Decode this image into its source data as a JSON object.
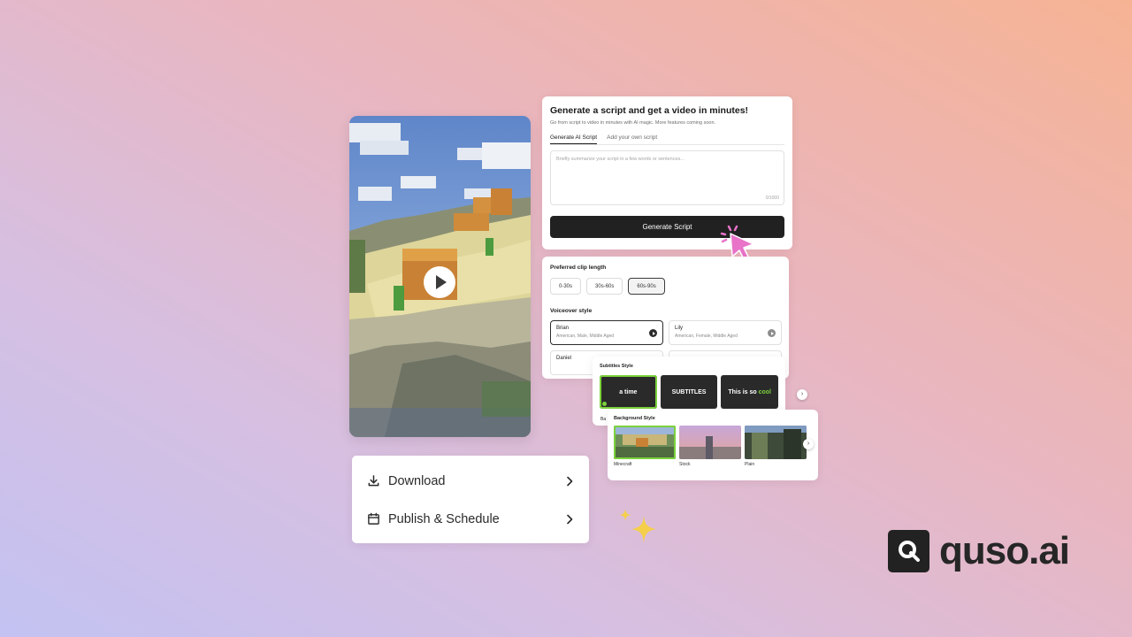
{
  "video": {
    "play_icon": "play-icon"
  },
  "script_generator": {
    "title": "Generate a script and get a video in minutes!",
    "subtitle": "Go from script to video in minutes with AI magic. More features coming soon.",
    "tabs": [
      "Generate AI Script",
      "Add your own script"
    ],
    "active_tab": "Generate AI Script",
    "input_placeholder": "Briefly summarize your script in a few words or sentences...",
    "char_count": "0/1000",
    "button_label": "Generate Script"
  },
  "clip_length": {
    "label": "Preferred clip length",
    "options": [
      "0-30s",
      "30s-60s",
      "60s-90s"
    ],
    "selected": "60s-90s"
  },
  "voiceover": {
    "label": "Voiceover style",
    "voices": [
      {
        "name": "Brian",
        "desc": "American, Male, Middle Aged",
        "selected": true
      },
      {
        "name": "Lily",
        "desc": "American, Female, Middle Aged",
        "selected": false
      },
      {
        "name": "Daniel",
        "desc": "",
        "selected": false
      },
      {
        "name": "",
        "desc": "",
        "selected": false
      }
    ]
  },
  "subtitles": {
    "label": "Subtitles Style",
    "tiles": [
      {
        "text": "a time",
        "highlight": ""
      },
      {
        "text": "SUBTITLES",
        "highlight": ""
      },
      {
        "text": "This is so ",
        "highlight": "cool"
      }
    ],
    "peek_label": "Ba"
  },
  "background": {
    "label": "Background Style",
    "items": [
      {
        "name": "Minecraft",
        "selected": true
      },
      {
        "name": "Stock",
        "selected": false
      },
      {
        "name": "Plain",
        "selected": false
      }
    ]
  },
  "actions": {
    "download_label": "Download",
    "publish_label": "Publish & Schedule"
  },
  "brand": {
    "name": "quso.ai"
  },
  "colors": {
    "accent_green": "#7bd23c",
    "cursor_pink": "#e873c8",
    "sparkle_yellow": "#f5cf4a",
    "button_dark": "#212121"
  }
}
